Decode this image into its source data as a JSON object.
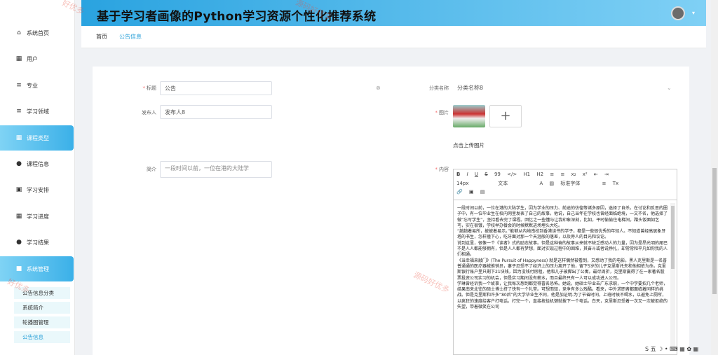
{
  "topbar": {
    "title": "基于学习者画像的Python学习资源个性化推荐系统"
  },
  "breadcrumb": {
    "home": "首页",
    "current": "公告信息"
  },
  "sidebar": {
    "items": [
      {
        "label": "系统首页",
        "icon": "home-icon"
      },
      {
        "label": "用户",
        "icon": "grid-icon"
      },
      {
        "label": "专业",
        "icon": "list-icon"
      },
      {
        "label": "学习领域",
        "icon": "list-icon"
      },
      {
        "label": "课程类型",
        "icon": "grid-icon"
      },
      {
        "label": "课程信息",
        "icon": "user-icon"
      },
      {
        "label": "学习安排",
        "icon": "clipboard-icon"
      },
      {
        "label": "学习进度",
        "icon": "grid-icon"
      },
      {
        "label": "学习结果",
        "icon": "pin-icon"
      },
      {
        "label": "系统管理",
        "icon": "briefcase-icon"
      }
    ],
    "submenu": [
      "公告信息分类",
      "系统简介",
      "轮播图管理",
      "公告信息"
    ]
  },
  "form": {
    "title_label": "标题",
    "title_value": "公告",
    "category_label": "分类名称",
    "category_value": "分类名称8",
    "publisher_label": "发布人",
    "publisher_value": "发布人8",
    "image_label": "图片",
    "upload_hint": "点击上传图片",
    "summary_label": "简介",
    "summary_value": "一段时间以前，一位在港的大陆学",
    "content_label": "内容"
  },
  "editor": {
    "toolbar_row1": [
      "B",
      "I",
      "U",
      "S",
      "99",
      "</>",
      "H1",
      "H2",
      "≡",
      "≡",
      "x₂",
      "x²",
      "⇤",
      "⇥"
    ],
    "font_size": "14px",
    "text_style": "文本",
    "font_family": "标准字体",
    "content": "一段时间以前，一位在港的大陆学生，因为学业的压力、前途的彷徨等诸多原因，选择了自杀。在讨论和反思的圈子中，有一位毕业生在校内网里发表了自己的故事。他说，自己当年在学校也曾经面临绝境，一文不名，他选择了做“忘写学生”，坚持看去完了课程。回忆之一些懂与让我印象深刻，比如，平时偷偷住电梯间，蹭头饭面如乞丐，实在很饿，学校举办餐会的时候默默进场埋头大吃。\n“趟趟着易所，披披着易示。”能够从内地南校到香港读书的学子，都是一些很优秀的年轻人。不知道曾经高居象牙塔的书生，怎样撞下心，吃牙面对那一个天涯般的落差，以及旁人的目光和议论。\n说到这里，很像一个《读者》式的励志故事。但是这种奋的故事从来就不缺乏感动人的力量，因为是昂光明的尾巴不是人人都能够拥有，但是人人都有梦想，面对实现过程中的困难，其奋斗或者说挣扎，却常常和平凡如你我的人们相通。\n《当幸福来敲门》(The Pursuit of Happyness) 就是这样偶然被看到，又感动了我的电影。黑人克里斯是一名普普通通的医疗器械推销员，妻子忍受不了经济上的压力离开了他，留下5岁的儿子克里斯托夫和他相依为命。克里斯银行账户里只剩下21块钱，因为没钱付房租，他和儿子被撵出了公寓。最尽周折，克里斯赢得了在一家著名股票投资公司实习的机会，但是实习期间没有薪水，而且最终只有一人可以成功进入公司。\n学琳曾经诉我一个故事，让我每次想到都觉得喜名恐怖。她说，她硕士毕业去广东求职，一个中学要招几个老师，结果南来北往的硕士博士挤了快有一个礼堂。可想而知，竞争有多么残酷。看来，中外求职者都面临着同样的挑战。但是克里斯和许多“80后”的大学毕业生不同，他是加证明-为了节省时间，上班时候不喝水，以避免上厕所，以疯狂的速度给客户打电话。打完一个，直接按挂机键就拨下一个电话。白天，克里斯忍受着一次又一次被拒绝的失望，带着微笑在公司"
  }
}
